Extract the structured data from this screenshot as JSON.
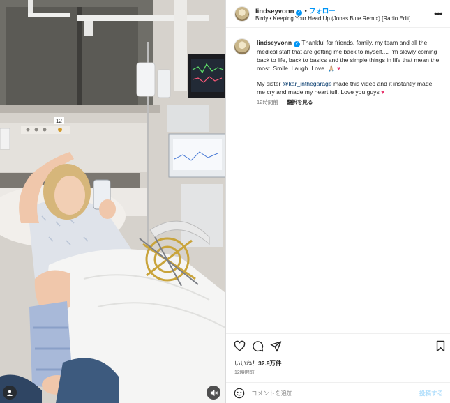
{
  "post": {
    "username": "lindseyvonn",
    "separator": "•",
    "follow_label": "フォロー",
    "song": "Birdy • Keeping Your Head Up (Jonas Blue Remix) [Radio Edit]",
    "more_icon": "more-horizontal-icon"
  },
  "caption": {
    "username": "lindseyvonn",
    "paragraph1": "Thankful for friends, family, my team and all the medical staff that are getting me back to myself.... I'm slowly coming back to life, back to basics and the simple things in life that mean the most. Smile. Laugh. Love. 🙏🏼",
    "heart1": "♥",
    "p2_before": "My sister ",
    "p2_mention": "@kar_inthegarage",
    "p2_after": " made this video and it instantly made me cry and made my heart full. Love you guys ",
    "heart2": "♥",
    "time_ago": "12時間前",
    "translate_label": "翻訳を見る"
  },
  "media": {
    "bed_number": "12",
    "icons": [
      "mute-icon",
      "user-tag-icon"
    ]
  },
  "actions": {
    "icons": [
      "like-icon",
      "comment-icon",
      "share-icon",
      "save-icon"
    ],
    "likes_prefix": "いいね！",
    "likes_count": "32.9万件",
    "time": "12時間前"
  },
  "comment": {
    "placeholder": "コメントを追加...",
    "post_label": "投稿する",
    "emoji_icon": "emoji-icon"
  },
  "colors": {
    "accent": "#0095f6",
    "heart": "#e8366e",
    "mention": "#00376b",
    "post_disabled": "#b2dffc"
  }
}
